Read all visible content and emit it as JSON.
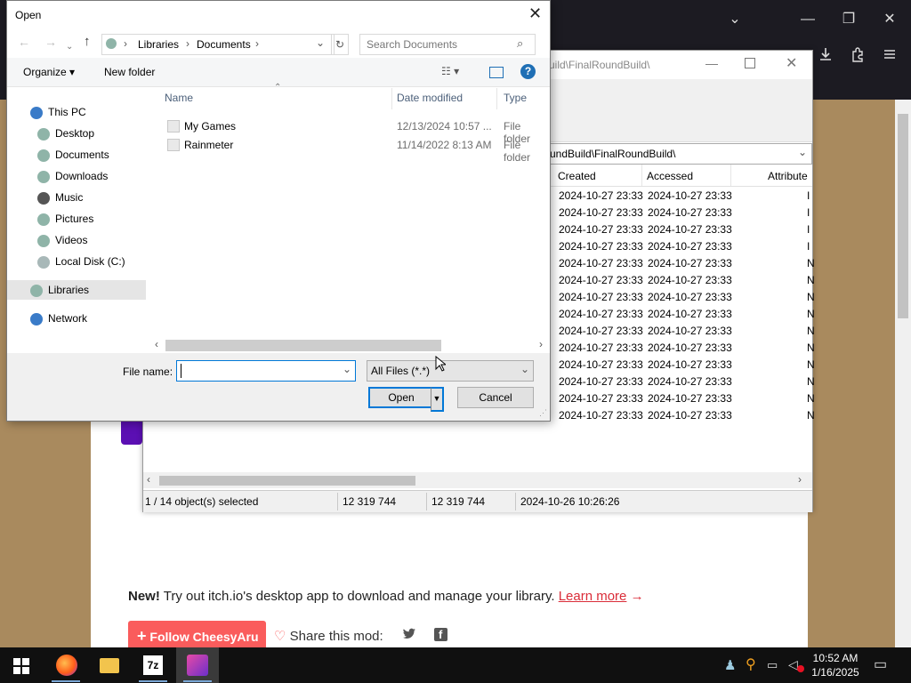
{
  "browser": {
    "title_chevron": "⌄",
    "minimize": "—",
    "maximize": "❐",
    "close": "✕",
    "download_icon": "download-icon",
    "extensions_icon": "extensions-icon",
    "menu_icon": "menu-icon"
  },
  "page": {
    "promo_new": "New!",
    "promo_text": " Try out itch.io's desktop app to download and manage your library. ",
    "promo_link": "Learn more",
    "promo_arrow": "→",
    "follow_label": "Follow CheesyAru",
    "share_label": "Share this mod:"
  },
  "zip": {
    "title_partial": "uild\\FinalRoundBuild\\",
    "path": "undBuild\\FinalRoundBuild\\",
    "columns": [
      "Created",
      "Accessed",
      "Attribute"
    ],
    "rows": [
      {
        "created": "2024-10-27 23:33",
        "accessed": "2024-10-27 23:33",
        "attr": "I"
      },
      {
        "created": "2024-10-27 23:33",
        "accessed": "2024-10-27 23:33",
        "attr": "I"
      },
      {
        "created": "2024-10-27 23:33",
        "accessed": "2024-10-27 23:33",
        "attr": "I"
      },
      {
        "created": "2024-10-27 23:33",
        "accessed": "2024-10-27 23:33",
        "attr": "I"
      },
      {
        "created": "2024-10-27 23:33",
        "accessed": "2024-10-27 23:33",
        "attr": "N"
      },
      {
        "created": "2024-10-27 23:33",
        "accessed": "2024-10-27 23:33",
        "attr": "N"
      },
      {
        "created": "2024-10-27 23:33",
        "accessed": "2024-10-27 23:33",
        "attr": "N"
      },
      {
        "created": "2024-10-27 23:33",
        "accessed": "2024-10-27 23:33",
        "attr": "N"
      },
      {
        "created": "2024-10-27 23:33",
        "accessed": "2024-10-27 23:33",
        "attr": "N"
      },
      {
        "created": "2024-10-27 23:33",
        "accessed": "2024-10-27 23:33",
        "attr": "N"
      },
      {
        "created": "2024-10-27 23:33",
        "accessed": "2024-10-27 23:33",
        "attr": "N"
      },
      {
        "created": "2024-10-27 23:33",
        "accessed": "2024-10-27 23:33",
        "attr": "N"
      },
      {
        "created": "2024-10-27 23:33",
        "accessed": "2024-10-27 23:33",
        "attr": "N"
      },
      {
        "created": "2024-10-27 23:33",
        "accessed": "2024-10-27 23:33",
        "attr": "N"
      }
    ],
    "status": {
      "selected": "1 / 14 object(s) selected",
      "size1": "12 319 744",
      "size2": "12 319 744",
      "modified": "2024-10-26 10:26:26"
    }
  },
  "dialog": {
    "title": "Open",
    "breadcrumb": [
      "Libraries",
      "Documents"
    ],
    "search_placeholder": "Search Documents",
    "organize": "Organize",
    "new_folder": "New folder",
    "nav": [
      {
        "label": "This PC"
      },
      {
        "label": "Desktop"
      },
      {
        "label": "Documents"
      },
      {
        "label": "Downloads"
      },
      {
        "label": "Music"
      },
      {
        "label": "Pictures"
      },
      {
        "label": "Videos"
      },
      {
        "label": "Local Disk (C:)"
      },
      {
        "label": "Libraries"
      },
      {
        "label": "Network"
      }
    ],
    "columns": {
      "name": "Name",
      "date": "Date modified",
      "type": "Type"
    },
    "files": [
      {
        "name": "My Games",
        "date": "12/13/2024 10:57 ...",
        "type": "File folder"
      },
      {
        "name": "Rainmeter",
        "date": "11/14/2022 8:13 AM",
        "type": "File folder"
      }
    ],
    "filename_label": "File name:",
    "filename_value": "",
    "filter": "All Files (*.*)",
    "open_button": "Open",
    "cancel_button": "Cancel"
  },
  "taskbar": {
    "time": "10:52 AM",
    "date": "1/16/2025"
  },
  "colors": {
    "follow_button": "#fa5c5c",
    "link": "#da2c38",
    "selection": "#e5e5e5",
    "focus_border": "#0078d7"
  }
}
